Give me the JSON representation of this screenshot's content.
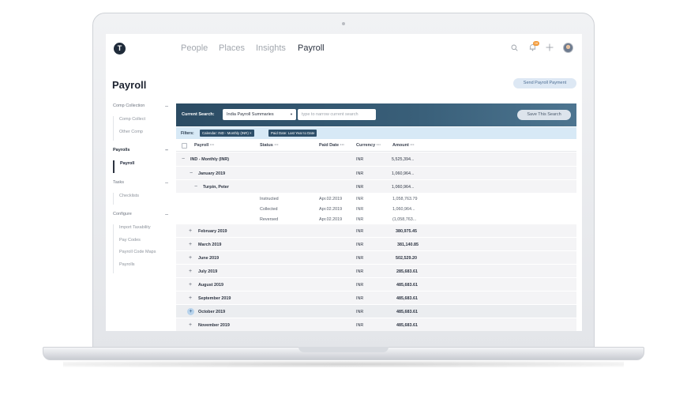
{
  "header": {
    "logo": "T",
    "nav": [
      "People",
      "Places",
      "Insights",
      "Payroll"
    ],
    "active_nav": "Payroll",
    "notification_count": "16",
    "icons": [
      "search-icon",
      "bell-icon",
      "plus-icon",
      "avatar"
    ]
  },
  "page": {
    "title": "Payroll",
    "send_button": "Send Payroll Payment"
  },
  "sidebar": {
    "sections": [
      {
        "title": "Comp Collection",
        "items": [
          "Comp Collect",
          "Other Comp"
        ]
      },
      {
        "title": "Payrolls",
        "items": [
          "Payroll"
        ],
        "active": "Payroll"
      },
      {
        "title": "Tasks",
        "items": [
          "Checklists"
        ]
      },
      {
        "title": "Configure",
        "items": [
          "Import Taxability",
          "Pay Codes",
          "Payroll Code Maps",
          "Payrolls"
        ]
      }
    ]
  },
  "search": {
    "label": "Current Search:",
    "selected": "India Payroll Summaries",
    "placeholder": "type to narrow current search",
    "save_button": "Save This Search"
  },
  "filters": {
    "label": "Filters:",
    "chips": [
      "Calendar: IND - Monthly (INR)",
      "Paid Date: Last Year to Date"
    ]
  },
  "table": {
    "columns": [
      "Payroll",
      "Status",
      "Paid Date",
      "Currency",
      "Amount"
    ],
    "rows": [
      {
        "toggle": "−",
        "payroll": "IND - Monthly (INR)",
        "currency": "INR",
        "amount": "5,525,394..."
      },
      {
        "toggle": "−",
        "payroll": "January 2019",
        "currency": "INR",
        "amount": "1,060,964..."
      },
      {
        "toggle": "−",
        "payroll": "Turpin, Peter",
        "currency": "INR",
        "amount": "1,060,964..."
      },
      {
        "status": "Instructed",
        "paid_date": "Apr.02.2019",
        "currency": "INR",
        "amount": "1,058,763.79"
      },
      {
        "status": "Collected",
        "paid_date": "Apr.02.2019",
        "currency": "INR",
        "amount": "1,060,964..."
      },
      {
        "status": "Reversed",
        "paid_date": "Apr.02.2019",
        "currency": "INR",
        "amount": "(1,058,763..."
      },
      {
        "toggle": "+",
        "payroll": "February 2019",
        "currency": "INR",
        "amount": "380,975.45"
      },
      {
        "toggle": "+",
        "payroll": "March 2019",
        "currency": "INR",
        "amount": "381,140.85"
      },
      {
        "toggle": "+",
        "payroll": "June 2019",
        "currency": "INR",
        "amount": "502,529.20"
      },
      {
        "toggle": "+",
        "payroll": "July 2019",
        "currency": "INR",
        "amount": "285,683.61"
      },
      {
        "toggle": "+",
        "payroll": "August 2019",
        "currency": "INR",
        "amount": "485,683.61"
      },
      {
        "toggle": "+",
        "payroll": "September 2019",
        "currency": "INR",
        "amount": "485,683.61"
      },
      {
        "toggle": "+",
        "payroll": "October 2019",
        "currency": "INR",
        "amount": "485,683.61"
      },
      {
        "toggle": "+",
        "payroll": "November 2019",
        "currency": "INR",
        "amount": "485,683.61"
      }
    ]
  }
}
